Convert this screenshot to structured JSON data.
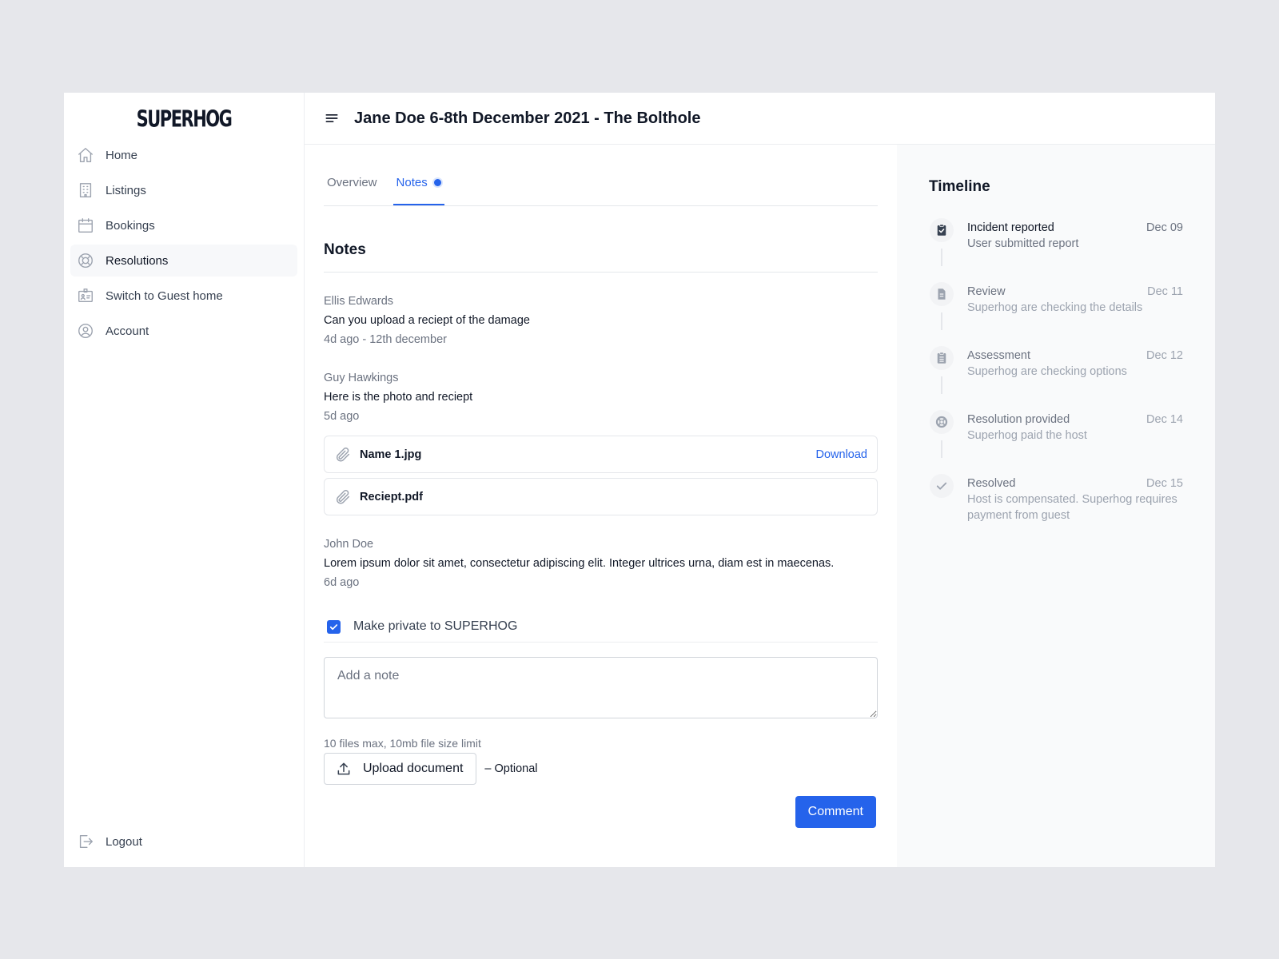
{
  "brand": {
    "logo_text": "SUPERHOG"
  },
  "sidebar": {
    "items": [
      {
        "label": "Home",
        "icon": "home-icon"
      },
      {
        "label": "Listings",
        "icon": "building-icon"
      },
      {
        "label": "Bookings",
        "icon": "calendar-icon"
      },
      {
        "label": "Resolutions",
        "icon": "lifebuoy-icon",
        "active": true
      },
      {
        "label": "Switch to Guest home",
        "icon": "id-card-icon"
      },
      {
        "label": "Account",
        "icon": "user-circle-icon"
      }
    ],
    "logout_label": "Logout"
  },
  "header": {
    "title": "Jane Doe 6-8th December 2021 - The Bolthole"
  },
  "tabs": [
    {
      "label": "Overview",
      "active": false
    },
    {
      "label": "Notes",
      "active": true
    }
  ],
  "notes_section": {
    "title": "Notes",
    "notes": [
      {
        "author": "Ellis Edwards",
        "text": "Can you upload a reciept of the damage",
        "time": "4d ago - 12th december"
      },
      {
        "author": "Guy Hawkings",
        "text": "Here is the photo and reciept",
        "time": "5d ago"
      },
      {
        "author": "John Doe",
        "text": "Lorem ipsum dolor sit amet, consectetur adipiscing elit. Integer ultrices urna, diam est in maecenas.",
        "time": "6d ago"
      }
    ],
    "attachments": [
      {
        "name": "Name 1.jpg",
        "action": "Download"
      },
      {
        "name": "Reciept.pdf"
      }
    ]
  },
  "compose": {
    "private_label": "Make private to SUPERHOG",
    "private_checked": true,
    "placeholder": "Add a note",
    "hint": "10 files max, 10mb file size limit",
    "upload_label": "Upload document",
    "optional_label": "– Optional",
    "submit_label": "Comment"
  },
  "timeline": {
    "title": "Timeline",
    "items": [
      {
        "name": "Incident reported",
        "desc": "User submitted report",
        "date": "Dec 09",
        "state": "done",
        "icon": "clipboard-check-icon"
      },
      {
        "name": "Review",
        "desc": "Superhog are checking the details",
        "date": "Dec 11",
        "state": "pending",
        "icon": "document-icon"
      },
      {
        "name": "Assessment",
        "desc": "Superhog are checking options",
        "date": "Dec 12",
        "state": "pending",
        "icon": "clipboard-list-icon"
      },
      {
        "name": "Resolution provided",
        "desc": "Superhog paid the host",
        "date": "Dec 14",
        "state": "pending",
        "icon": "lifebuoy-icon"
      },
      {
        "name": "Resolved",
        "desc": "Host is compensated. Superhog requires payment from guest",
        "date": "Dec 15",
        "state": "pending",
        "icon": "check-icon"
      }
    ]
  },
  "colors": {
    "accent": "#2563eb",
    "background": "#e6e7eb",
    "panel": "#f9fafb"
  }
}
